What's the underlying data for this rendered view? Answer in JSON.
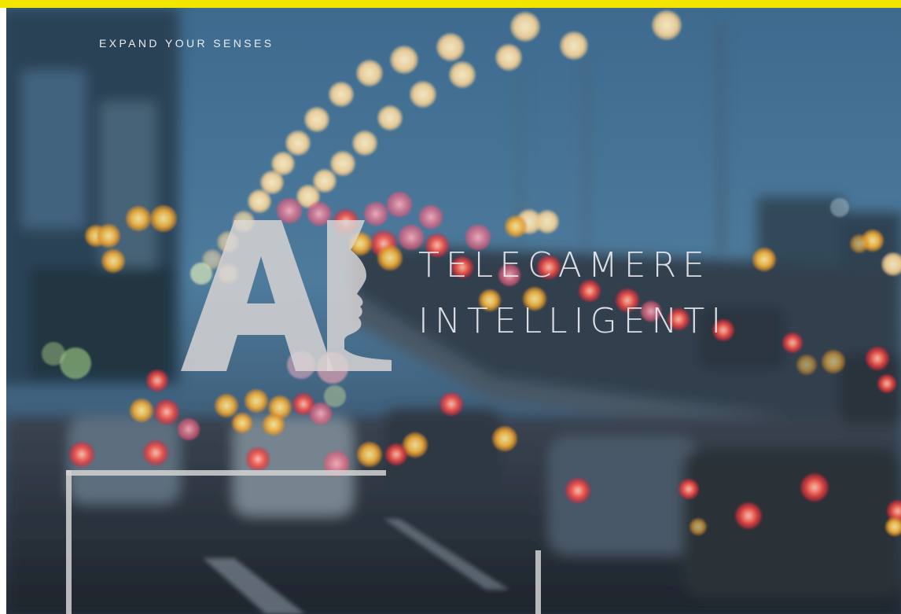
{
  "tagline": "EXPAND YOUR SENSES",
  "logo": {
    "monogram": "AI"
  },
  "title": {
    "line1": "TELECAMERE",
    "line2": "INTELLIGENTI"
  },
  "colors": {
    "accent": "#f2e600",
    "overlay_text": "#eef0f4",
    "frame": "#d2d2d2"
  }
}
